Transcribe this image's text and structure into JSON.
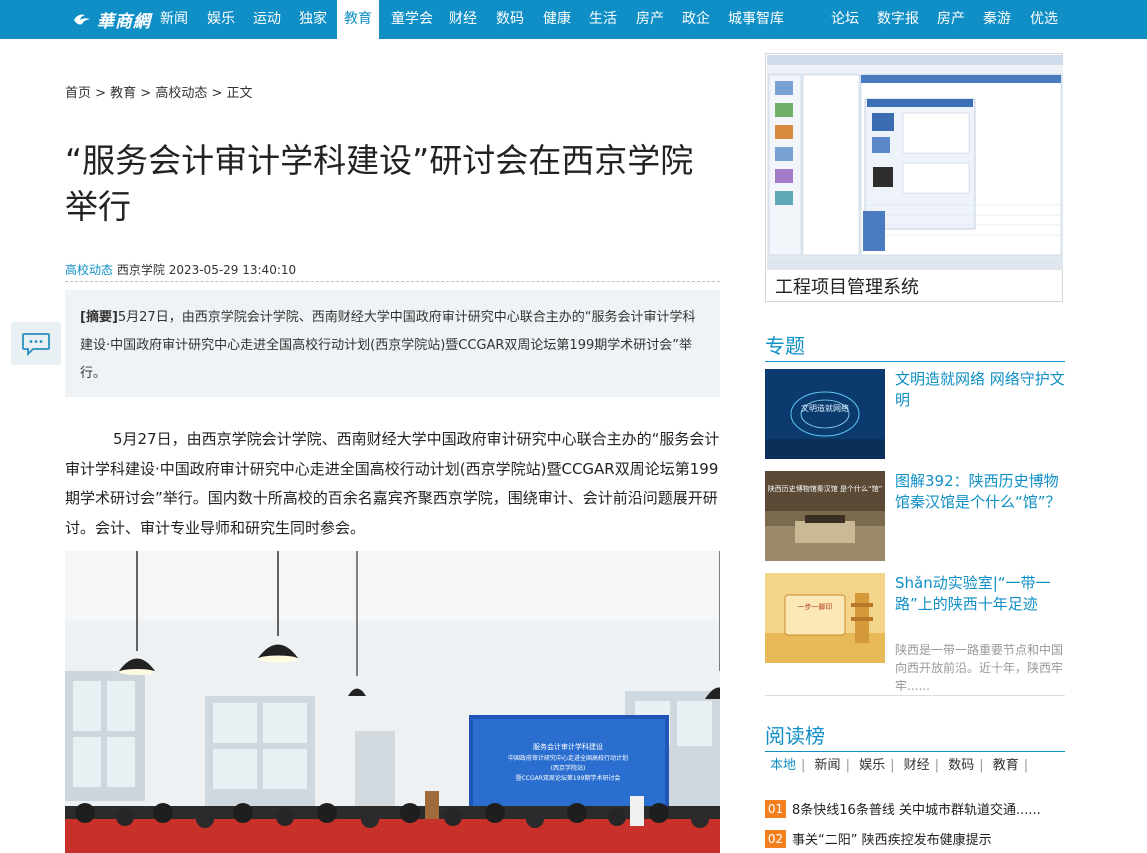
{
  "site": {
    "logo_text": "華商網"
  },
  "nav": {
    "items": [
      "新闻",
      "娱乐",
      "运动",
      "独家",
      "教育",
      "童学会",
      "财经",
      "数码",
      "健康",
      "生活",
      "房产",
      "政企",
      "城事智库"
    ],
    "active": "教育",
    "right_items": [
      "论坛",
      "数字报",
      "房产",
      "秦游",
      "优选"
    ]
  },
  "breadcrumb": {
    "text": "首页 > 教育 > 高校动态 > 正文"
  },
  "article": {
    "title": "“服务会计审计学科建设”研讨会在西京学院举行",
    "category": "高校动态",
    "source": "西京学院",
    "datetime": "2023-05-29 13:40:10",
    "abstract_label": "[摘要]",
    "abstract": "5月27日，由西京学院会计学院、西南财经大学中国政府审计研究中心联合主办的“服务会计审计学科建设·中国政府审计研究中心走进全国高校行动计划(西京学院站)暨CCGAR双周论坛第199期学术研讨会”举行。",
    "body": "5月27日，由西京学院会计学院、西南财经大学中国政府审计研究中心联合主办的“服务会计审计学科建设·中国政府审计研究中心走进全国高校行动计划(西京学院站)暨CCGAR双周论坛第199期学术研讨会”举行。国内数十所高校的百余名嘉宾齐聚西京学院，围绕审计、会计前沿问题展开研讨。会计、审计专业导师和研究生同时参会。",
    "photo_screen_text": [
      "服务会计审计学科建设",
      "中国政府审计研究中心走进全国高校行动计划",
      "(西京学院站)",
      "暨CCGAR双周论坛第199期学术研讨会"
    ]
  },
  "ad": {
    "caption": "工程项目管理系统"
  },
  "topics": {
    "heading": "专题",
    "items": [
      {
        "title": "文明造就网络 网络守护文明",
        "desc": "",
        "img_text": "文明造就网络"
      },
      {
        "title": "图解392：陕西历史博物馆秦汉馆是个什么“馆”？",
        "desc": "",
        "img_text": "陕西历史博物馆秦汉馆 是个什么“馆”"
      },
      {
        "title": "Shǎn动实验室|“一带一路”上的陕西十年足迹",
        "desc": "陕西是一带一路重要节点和中国向西开放前沿。近十年，陕西牢牢......",
        "img_text": "一步一脚印"
      }
    ]
  },
  "ranking": {
    "heading": "阅读榜",
    "tabs": [
      "本地",
      "新闻",
      "娱乐",
      "财经",
      "数码",
      "教育"
    ],
    "items": [
      {
        "num": "01",
        "text": "8条快线16条普线 关中城市群轨道交通......"
      },
      {
        "num": "02",
        "text": "事关“二阳” 陕西疾控发布健康提示"
      }
    ]
  },
  "colors": {
    "brand": "#0f8fc6",
    "rank_badge": "#f47f1f"
  }
}
